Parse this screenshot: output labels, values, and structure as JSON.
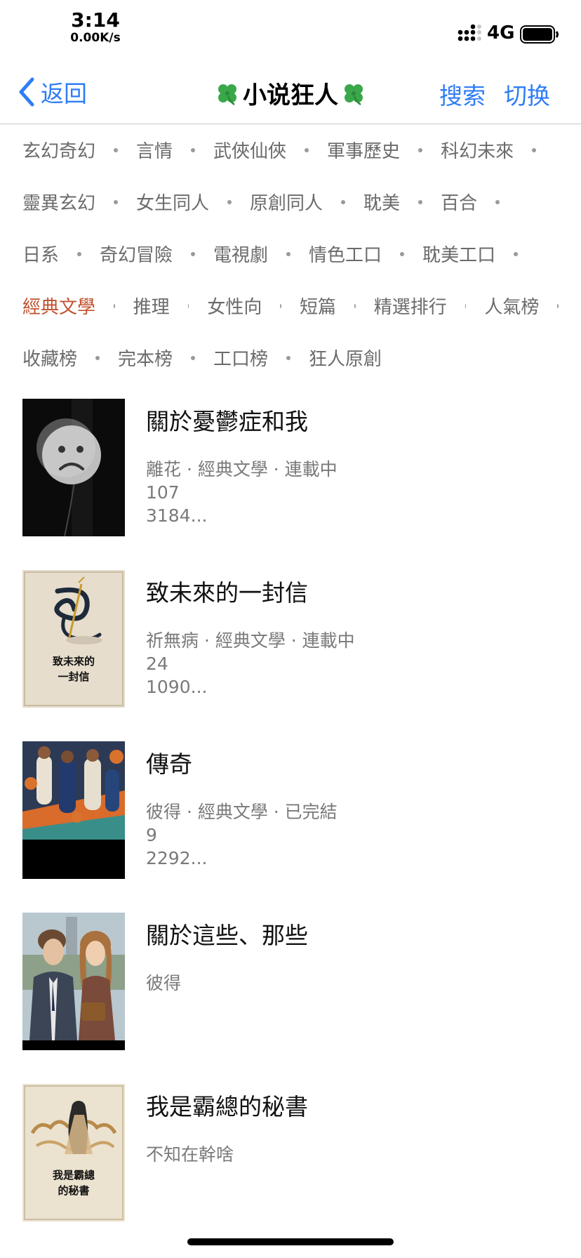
{
  "status_bar": {
    "time": "3:14",
    "speed": "0.00K/s",
    "network": "4G"
  },
  "nav": {
    "back_label": "返回",
    "title": "小说狂人",
    "search_label": "搜索",
    "switch_label": "切换",
    "accent_color": "#2f7df6"
  },
  "categories": {
    "rows": [
      [
        "玄幻奇幻",
        "言情",
        "武俠仙俠",
        "軍事歷史",
        "科幻未來"
      ],
      [
        "靈異玄幻",
        "女生同人",
        "原創同人",
        "耽美",
        "百合"
      ],
      [
        "日系",
        "奇幻冒險",
        "電視劇",
        "情色工口",
        "耽美工口"
      ],
      [
        "經典文學",
        "推理",
        "女性向",
        "短篇",
        "精選排行",
        "人氣榜"
      ],
      [
        "收藏榜",
        "完本榜",
        "工口榜",
        "狂人原創"
      ]
    ],
    "active": "經典文學",
    "active_color": "#c2522f"
  },
  "books": [
    {
      "title": "關於憂鬱症和我",
      "meta": [
        "離花 · 經典文學 · 連載中",
        "107",
        "3184..."
      ],
      "cover_icon": "sad-face-balloon-cover"
    },
    {
      "title": "致未來的一封信",
      "meta": [
        "祈無病 · 經典文學 · 連載中",
        "24",
        "1090..."
      ],
      "cover_icon": "ink-dragon-cover",
      "cover_text": [
        "致未來的",
        "一封信"
      ]
    },
    {
      "title": "傳奇",
      "meta": [
        "彼得 · 經典文學 · 已完結",
        "9",
        "2292..."
      ],
      "cover_icon": "basketball-players-cover"
    },
    {
      "title": "關於這些、那些",
      "meta": [
        "彼得"
      ],
      "cover_icon": "couple-portrait-cover"
    },
    {
      "title": "我是霸總的秘書",
      "meta": [
        "不知在幹啥"
      ],
      "cover_icon": "lady-clouds-cover",
      "cover_text": [
        "我是霸總",
        "的秘書"
      ]
    }
  ]
}
